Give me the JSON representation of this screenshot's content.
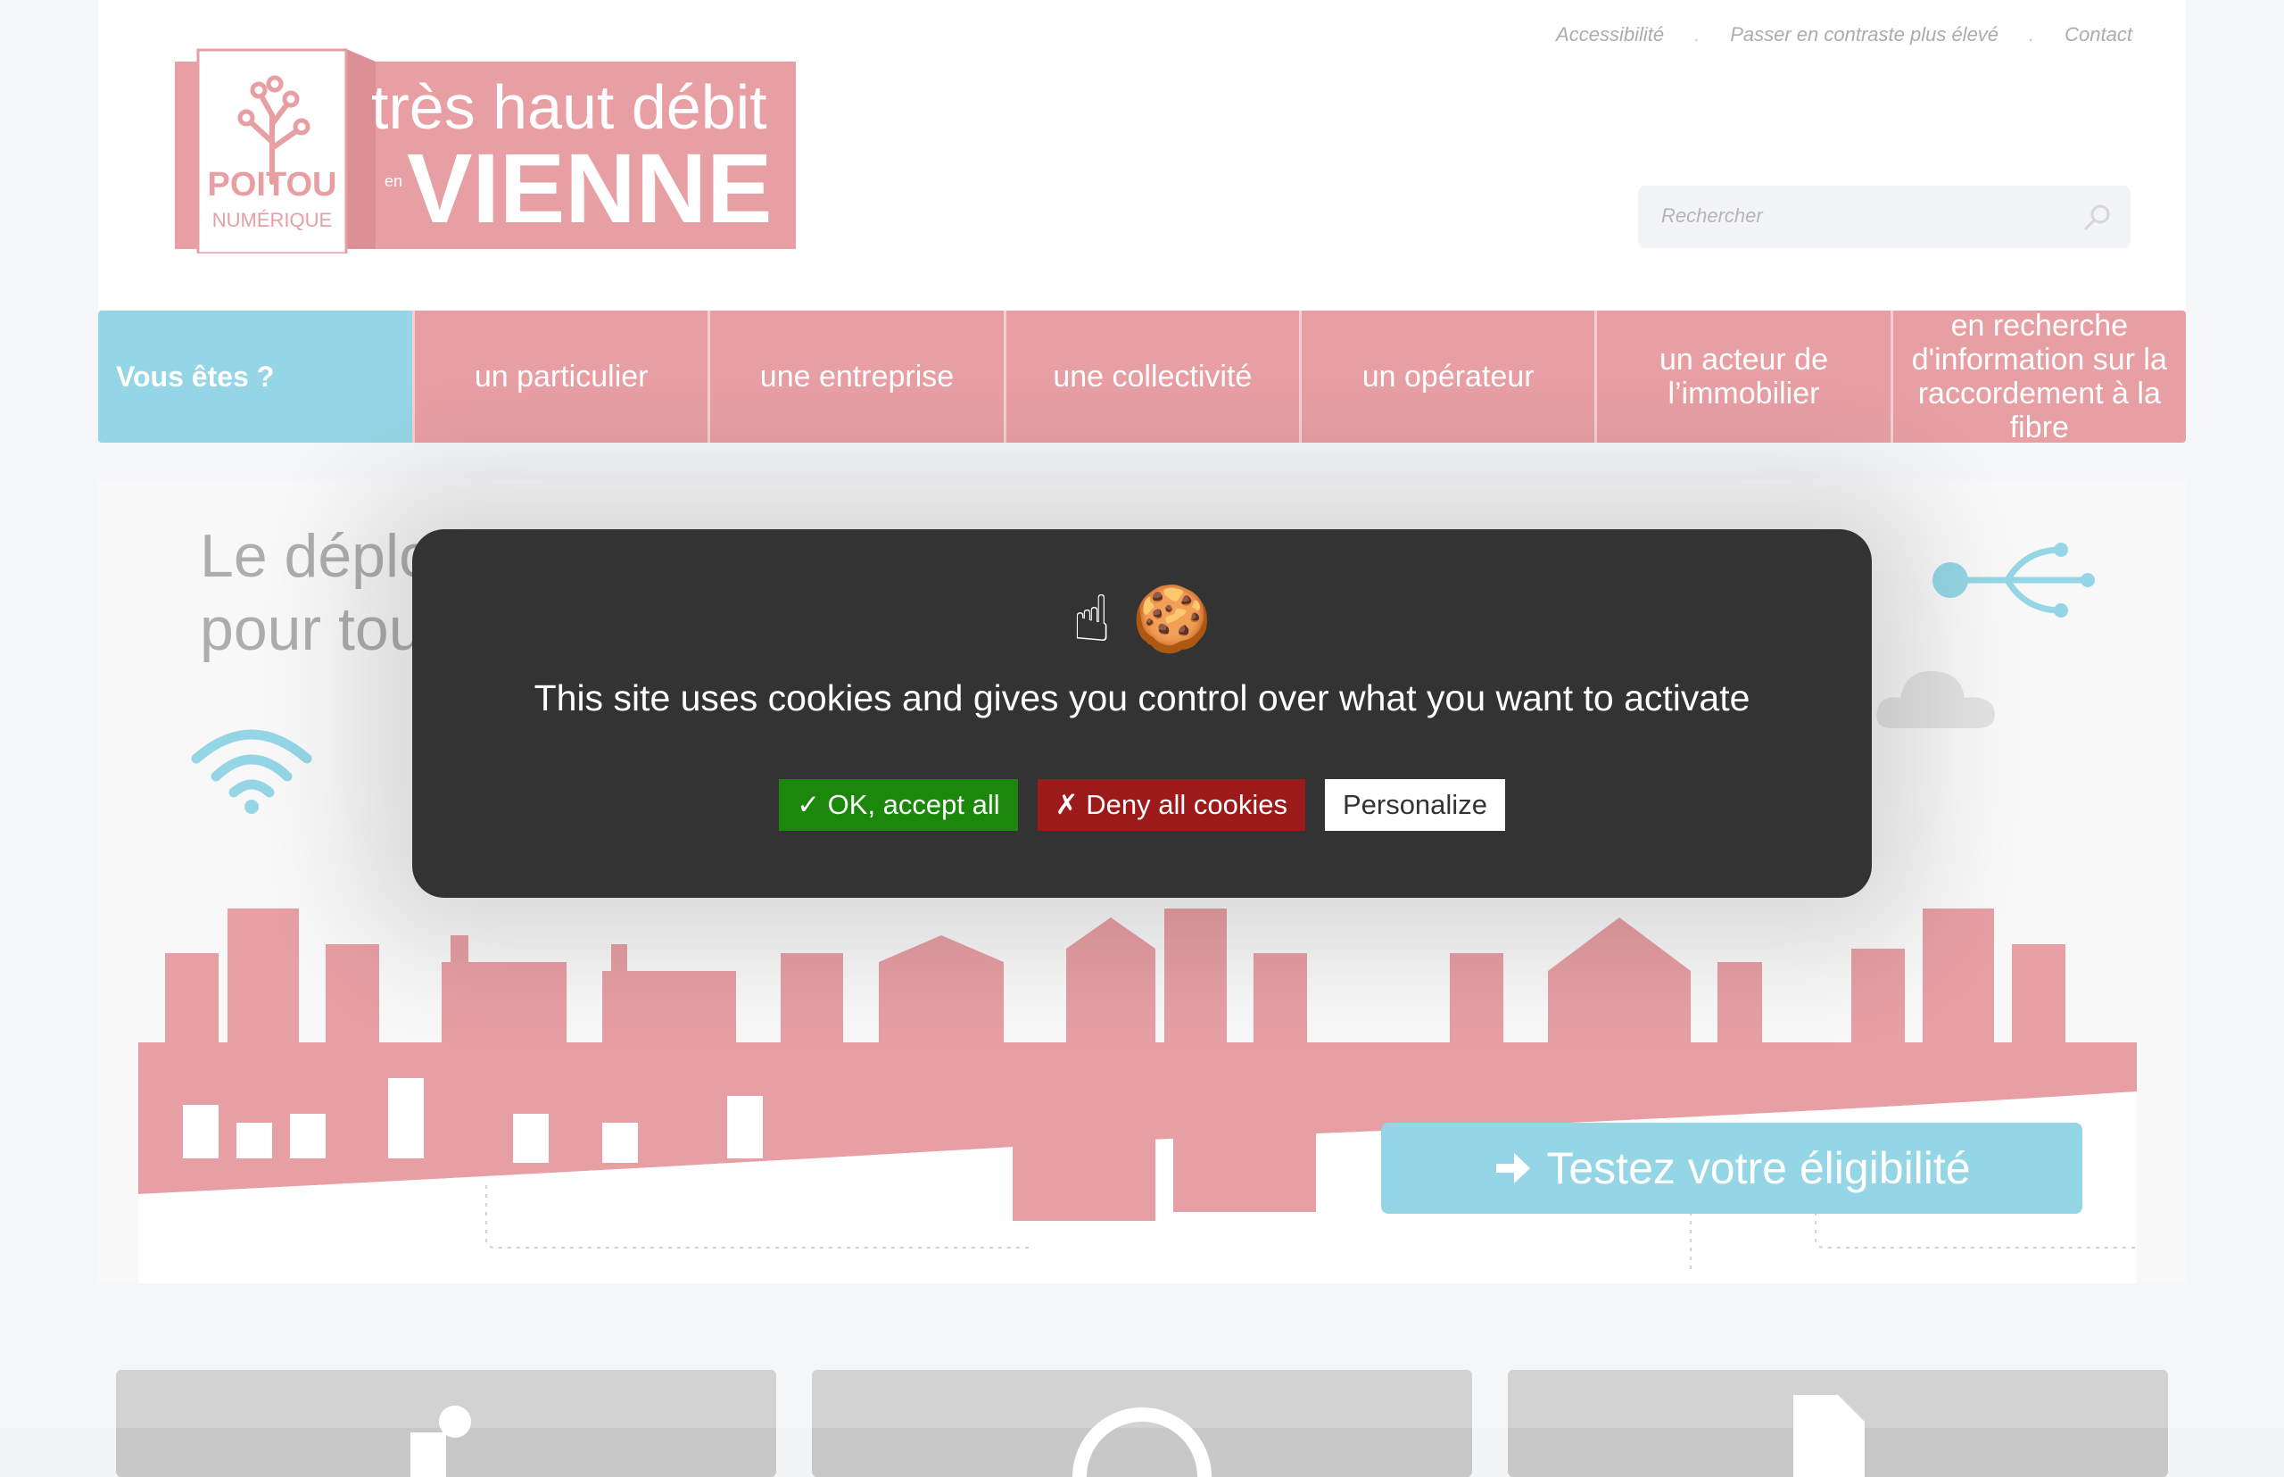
{
  "toplinks": {
    "accessibility": "Accessibilité",
    "contrast": "Passer en contraste plus élevé",
    "contact": "Contact",
    "separator": "."
  },
  "logo": {
    "line1": "très haut débit",
    "prefix": "en",
    "line2": "VIENNE",
    "brand_top": "POITOU",
    "brand_bottom": "NUMÉRIQUE"
  },
  "search": {
    "placeholder": "Rechercher"
  },
  "nav": {
    "label": "Vous êtes ?",
    "items": [
      "un particulier",
      "une entreprise",
      "une collectivité",
      "un opérateur",
      "un acteur de l’immobilier",
      "en recherche d'information sur la raccordement à la fibre"
    ]
  },
  "hero": {
    "title_line1": "Le déplo",
    "title_line2": "pour tou",
    "cta": "Testez votre éligibilité"
  },
  "cookie": {
    "emoji": "☝ 🍪",
    "message": "This site uses cookies and gives you control over what you want to activate",
    "accept": "✓ OK, accept all",
    "deny": "✗ Deny all cookies",
    "personalize": "Personalize"
  },
  "colors": {
    "pink": "#e28a90",
    "blue": "#7dcde0",
    "dialog": "#333333",
    "accept": "#1b870b",
    "deny": "#9c1a1a"
  }
}
